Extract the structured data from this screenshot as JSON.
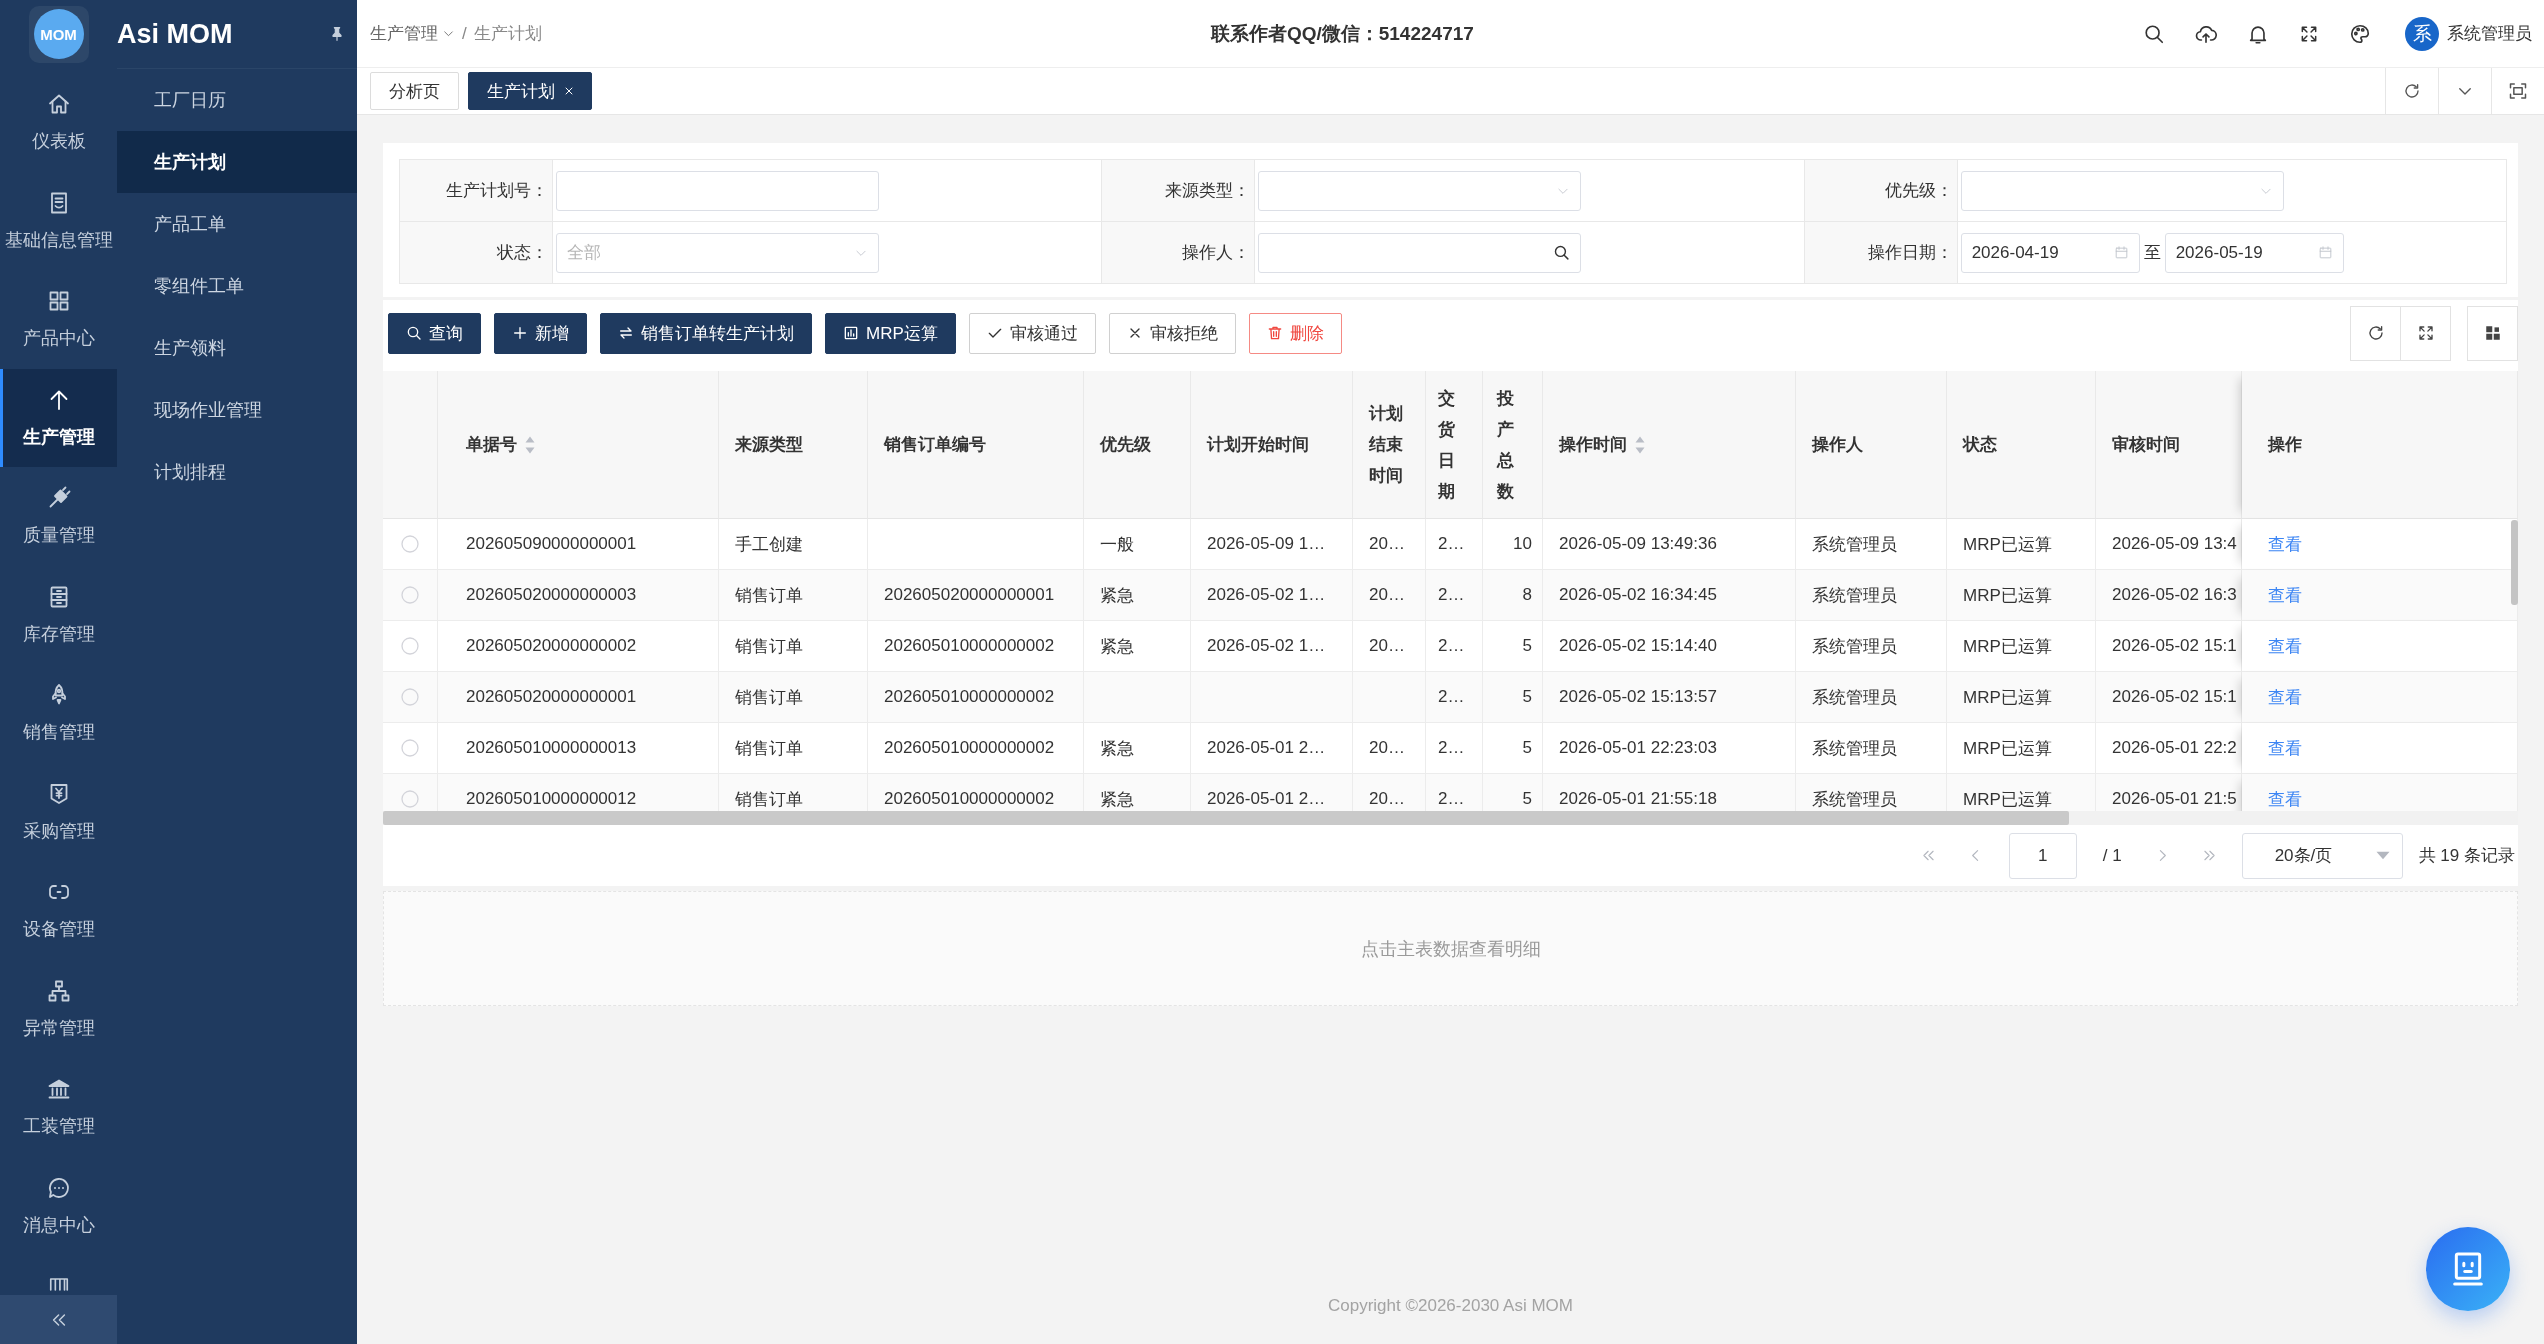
{
  "app": {
    "logo_text": "MOM",
    "name": "Asi MOM"
  },
  "rail": {
    "items": [
      {
        "label": "仪表板",
        "selected": false
      },
      {
        "label": "基础信息管理",
        "selected": false
      },
      {
        "label": "产品中心",
        "selected": false
      },
      {
        "label": "生产管理",
        "selected": true
      },
      {
        "label": "质量管理",
        "selected": false
      },
      {
        "label": "库存管理",
        "selected": false
      },
      {
        "label": "销售管理",
        "selected": false
      },
      {
        "label": "采购管理",
        "selected": false
      },
      {
        "label": "设备管理",
        "selected": false
      },
      {
        "label": "异常管理",
        "selected": false
      },
      {
        "label": "工装管理",
        "selected": false
      },
      {
        "label": "消息中心",
        "selected": false
      }
    ]
  },
  "submenu": {
    "items": [
      {
        "label": "工厂日历",
        "selected": false
      },
      {
        "label": "生产计划",
        "selected": true
      },
      {
        "label": "产品工单",
        "selected": false
      },
      {
        "label": "零组件工单",
        "selected": false
      },
      {
        "label": "生产领料",
        "selected": false
      },
      {
        "label": "现场作业管理",
        "selected": false
      },
      {
        "label": "计划排程",
        "selected": false
      }
    ]
  },
  "header": {
    "breadcrumb": {
      "items": [
        {
          "label": "生产管理",
          "dropdown": true
        },
        {
          "label": "生产计划",
          "dropdown": false
        }
      ],
      "separator": "/"
    },
    "contact": "联系作者QQ/微信：514224717",
    "user": {
      "avatar_text": "系",
      "name": "系统管理员"
    }
  },
  "tabs": [
    {
      "label": "分析页",
      "selected": false,
      "closable": false
    },
    {
      "label": "生产计划",
      "selected": true,
      "closable": true
    }
  ],
  "filters": [
    {
      "label": "生产计划号：",
      "kind": "text"
    },
    {
      "label": "来源类型：",
      "kind": "select"
    },
    {
      "label": "优先级：",
      "kind": "select"
    },
    {
      "label": "状态：",
      "kind": "select",
      "placeholder": "全部"
    },
    {
      "label": "操作人：",
      "kind": "search"
    },
    {
      "label": "操作日期：",
      "kind": "date_range",
      "start": "2026-04-19",
      "separator": "至",
      "end": "2026-05-19"
    }
  ],
  "toolbar": {
    "buttons": [
      {
        "label": "查询",
        "kind": "primary"
      },
      {
        "label": "新增",
        "kind": "primary"
      },
      {
        "label": "销售订单转生产计划",
        "kind": "primary"
      },
      {
        "label": "MRP运算",
        "kind": "primary"
      },
      {
        "label": "审核通过",
        "kind": "default"
      },
      {
        "label": "审核拒绝",
        "kind": "default"
      },
      {
        "label": "删除",
        "kind": "danger"
      }
    ]
  },
  "table": {
    "columns": [
      {
        "label": "单据号",
        "sortable": true
      },
      {
        "label": "来源类型",
        "sortable": false
      },
      {
        "label": "销售订单编号",
        "sortable": false
      },
      {
        "label": "优先级",
        "sortable": false
      },
      {
        "label": "计划开始时间",
        "sortable": false
      },
      {
        "label": "计划结束时间",
        "sortable": false
      },
      {
        "label": "交货日期",
        "sortable": false
      },
      {
        "label": "投产总数",
        "sortable": false
      },
      {
        "label": "操作时间",
        "sortable": true
      },
      {
        "label": "操作人",
        "sortable": false
      },
      {
        "label": "状态",
        "sortable": false
      },
      {
        "label": "审核时间",
        "sortable": false
      },
      {
        "label": "操作",
        "sortable": false
      }
    ],
    "rows": [
      {
        "selected": false,
        "doc_no": "202605090000000001",
        "source_type": "手工创建",
        "priority": "一般",
        "plan_start": "2026-05-09 1…",
        "plan_end": "20…",
        "delivery_date": "2…",
        "quantity": "10",
        "operated_at": "2026-05-09 13:49:36",
        "operator": "系统管理员",
        "status": "MRP已运算",
        "audited_at": "2026-05-09 13:4",
        "action": "查看"
      },
      {
        "selected": false,
        "doc_no": "202605020000000003",
        "source_type": "销售订单",
        "sales_order_no": "202605020000000001",
        "priority": "紧急",
        "plan_start": "2026-05-02 1…",
        "plan_end": "20…",
        "delivery_date": "2…",
        "quantity": "8",
        "operated_at": "2026-05-02 16:34:45",
        "operator": "系统管理员",
        "status": "MRP已运算",
        "audited_at": "2026-05-02 16:3",
        "action": "查看"
      },
      {
        "selected": false,
        "doc_no": "202605020000000002",
        "source_type": "销售订单",
        "sales_order_no": "202605010000000002",
        "priority": "紧急",
        "plan_start": "2026-05-02 1…",
        "plan_end": "20…",
        "delivery_date": "2…",
        "quantity": "5",
        "operated_at": "2026-05-02 15:14:40",
        "operator": "系统管理员",
        "status": "MRP已运算",
        "audited_at": "2026-05-02 15:1",
        "action": "查看"
      },
      {
        "selected": false,
        "doc_no": "202605020000000001",
        "source_type": "销售订单",
        "sales_order_no": "202605010000000002",
        "delivery_date": "2…",
        "quantity": "5",
        "operated_at": "2026-05-02 15:13:57",
        "operator": "系统管理员",
        "status": "MRP已运算",
        "audited_at": "2026-05-02 15:1",
        "action": "查看"
      },
      {
        "selected": false,
        "doc_no": "202605010000000013",
        "source_type": "销售订单",
        "sales_order_no": "202605010000000002",
        "priority": "紧急",
        "plan_start": "2026-05-01 2…",
        "plan_end": "20…",
        "delivery_date": "2…",
        "quantity": "5",
        "operated_at": "2026-05-01 22:23:03",
        "operator": "系统管理员",
        "status": "MRP已运算",
        "audited_at": "2026-05-01 22:2",
        "action": "查看"
      },
      {
        "selected": false,
        "doc_no": "202605010000000012",
        "source_type": "销售订单",
        "sales_order_no": "202605010000000002",
        "priority": "紧急",
        "plan_start": "2026-05-01 2…",
        "plan_end": "20…",
        "delivery_date": "2…",
        "quantity": "5",
        "operated_at": "2026-05-01 21:55:18",
        "operator": "系统管理员",
        "status": "MRP已运算",
        "audited_at": "2026-05-01 21:5",
        "action": "查看"
      }
    ]
  },
  "pagination": {
    "page": "1",
    "total_pages": "/ 1",
    "page_size": "20条/页",
    "summary": "共 19 条记录"
  },
  "detail_panel": {
    "message": "点击主表数据查看明细"
  },
  "footer": {
    "copyright": "Copyright ©2026-2030 Asi MOM"
  }
}
